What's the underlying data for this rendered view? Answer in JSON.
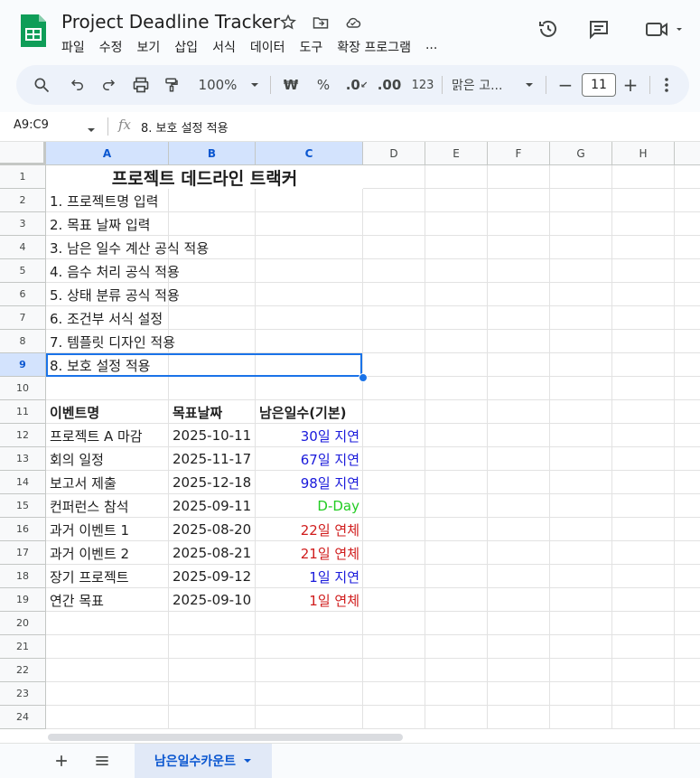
{
  "app": {
    "title": "Project Deadline Tracker",
    "brand_color": "#0f9d58"
  },
  "menu": [
    "파일",
    "수정",
    "보기",
    "삽입",
    "서식",
    "데이터",
    "도구",
    "확장 프로그램",
    "..."
  ],
  "toolbar": {
    "zoom": "100%",
    "currency": "₩",
    "percent": "%",
    "decimal_decrease": ".0",
    "decimal_increase": ".00",
    "number_format": "123",
    "font_name": "맑은 고...",
    "font_size": "11",
    "minus": "−",
    "plus": "+"
  },
  "formula_bar": {
    "name_box": "A9:C9",
    "fx": "fx",
    "content": "8. 보호 설정 적용"
  },
  "columns": [
    "A",
    "B",
    "C",
    "D",
    "E",
    "F",
    "G",
    "H"
  ],
  "rows": [
    "1",
    "2",
    "3",
    "4",
    "5",
    "6",
    "7",
    "8",
    "9",
    "10",
    "11",
    "12",
    "13",
    "14",
    "15",
    "16",
    "17",
    "18",
    "19",
    "20",
    "21",
    "22",
    "23",
    "24"
  ],
  "cells": {
    "title": "프로젝트 데드라인 트랙커",
    "steps": [
      "1. 프로젝트명 입력",
      "2. 목표 날짜 입력",
      "3. 남은 일수 계산 공식 적용",
      "4. 음수 처리 공식 적용",
      "5. 상태 분류 공식 적용",
      "6. 조건부 서식 설정",
      "7. 템플릿 디자인 적용",
      "8. 보호 설정 적용"
    ],
    "headers": [
      "이벤트명",
      "목표날짜",
      "남은일수(기본)"
    ],
    "events": [
      {
        "name": "프로젝트 A 마감",
        "date": "2025-10-11",
        "remaining": "30일 지연",
        "color": "#1a1adb"
      },
      {
        "name": "회의 일정",
        "date": "2025-11-17",
        "remaining": "67일 지연",
        "color": "#1a1adb"
      },
      {
        "name": "보고서 제출",
        "date": "2025-12-18",
        "remaining": "98일 지연",
        "color": "#1a1adb"
      },
      {
        "name": "컨퍼런스 참석",
        "date": "2025-09-11",
        "remaining": "D-Day",
        "color": "#22cc22"
      },
      {
        "name": "과거 이벤트 1",
        "date": "2025-08-20",
        "remaining": "22일 연체",
        "color": "#d01c1c"
      },
      {
        "name": "과거 이벤트 2",
        "date": "2025-08-21",
        "remaining": "21일 연체",
        "color": "#d01c1c"
      },
      {
        "name": "장기 프로젝트",
        "date": "2025-09-12",
        "remaining": "1일 지연",
        "color": "#1a1adb"
      },
      {
        "name": "연간 목표",
        "date": "2025-09-10",
        "remaining": "1일 연체",
        "color": "#d01c1c"
      }
    ]
  },
  "sheet_tab": "남은일수카운트"
}
